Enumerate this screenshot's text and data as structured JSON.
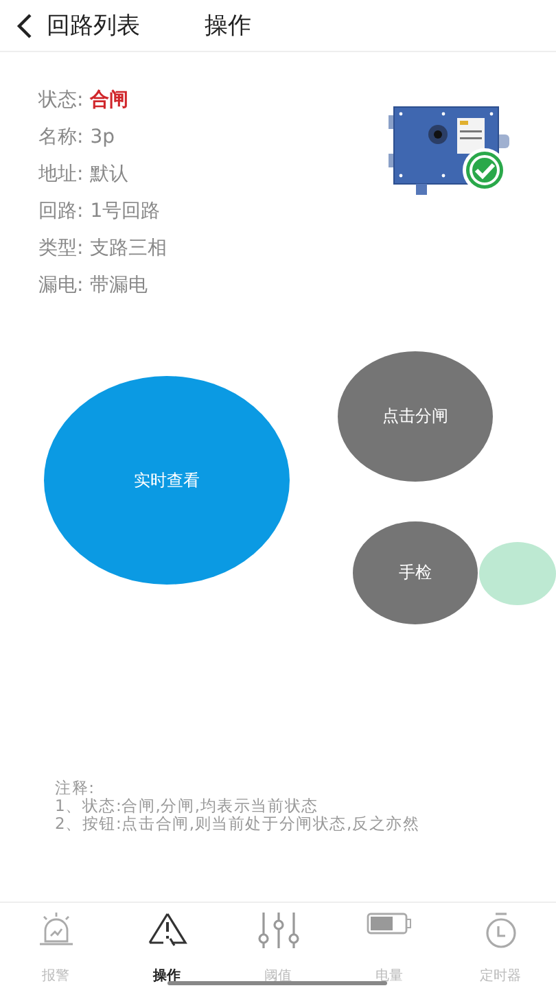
{
  "header": {
    "back_label": "回路列表",
    "title": "操作"
  },
  "info": [
    {
      "label": "状态:",
      "value": "合闸",
      "kind": "alert"
    },
    {
      "label": "名称:",
      "value": "3p",
      "kind": "plain"
    },
    {
      "label": "地址:",
      "value": "默认",
      "kind": "plain"
    },
    {
      "label": "回路:",
      "value": "1号回路",
      "kind": "plain"
    },
    {
      "label": "类型:",
      "value": "支路三相",
      "kind": "plain"
    },
    {
      "label": "漏电:",
      "value": "带漏电",
      "kind": "plain"
    }
  ],
  "buttons": {
    "live_view": "实时查看",
    "open_switch": "点击分闸",
    "manual_check": "手检"
  },
  "notes": [
    "注释:",
    "1、状态:合闸,分闸,均表示当前状态",
    "2、按钮:点击合闸,则当前处于分闸状态,反之亦然"
  ],
  "tabs": [
    {
      "label": "报警",
      "kind": "alarm",
      "selected": false
    },
    {
      "label": "操作",
      "kind": "warning",
      "selected": true
    },
    {
      "label": "阈值",
      "kind": "sliders",
      "selected": false
    },
    {
      "label": "电量",
      "kind": "battery",
      "selected": false
    },
    {
      "label": "定时器",
      "kind": "timer",
      "selected": false
    }
  ]
}
